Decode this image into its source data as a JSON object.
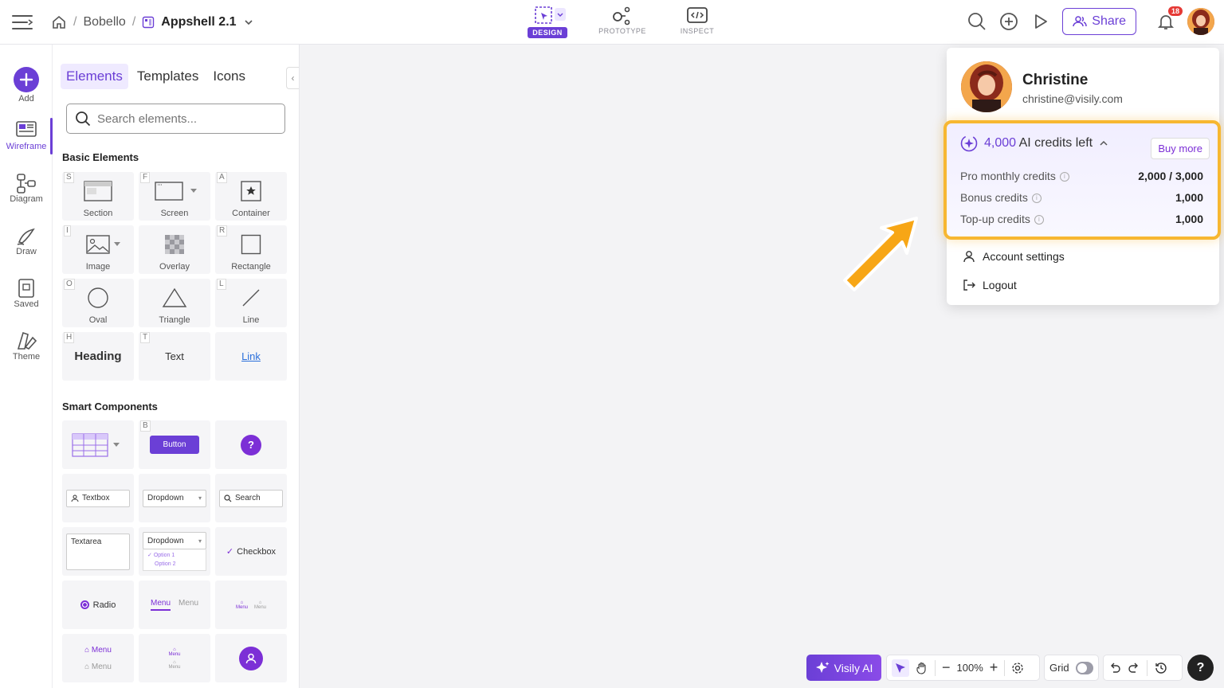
{
  "header": {
    "home_crumb": "Bobello",
    "project_name": "Appshell 2.1",
    "mode_tabs": [
      {
        "label": "DESIGN",
        "icon": "design-icon"
      },
      {
        "label": "PROTOTYPE",
        "icon": "prototype-icon"
      },
      {
        "label": "INSPECT",
        "icon": "inspect-icon"
      }
    ],
    "share_label": "Share",
    "notification_count": "18"
  },
  "rail": {
    "items": [
      {
        "label": "Add"
      },
      {
        "label": "Wireframe"
      },
      {
        "label": "Diagram"
      },
      {
        "label": "Draw"
      },
      {
        "label": "Saved"
      },
      {
        "label": "Theme"
      }
    ]
  },
  "panel": {
    "tabs": [
      "Elements",
      "Templates",
      "Icons"
    ],
    "search_placeholder": "Search elements...",
    "basic_title": "Basic Elements",
    "basic": [
      {
        "key": "S",
        "label": "Section"
      },
      {
        "key": "F",
        "label": "Screen"
      },
      {
        "key": "A",
        "label": "Container"
      },
      {
        "key": "I",
        "label": "Image"
      },
      {
        "key": "",
        "label": "Overlay"
      },
      {
        "key": "R",
        "label": "Rectangle"
      },
      {
        "key": "O",
        "label": "Oval"
      },
      {
        "key": "",
        "label": "Triangle"
      },
      {
        "key": "L",
        "label": "Line"
      },
      {
        "key": "H",
        "label": "Heading"
      },
      {
        "key": "T",
        "label": "Text"
      },
      {
        "key": "",
        "label": "Link"
      }
    ],
    "smart_title": "Smart Components",
    "smart": {
      "button_key": "B",
      "button_label": "Button",
      "help_glyph": "?",
      "textbox": "Textbox",
      "dropdown": "Dropdown",
      "search": "Search",
      "textarea": "Textarea",
      "dropdown2": "Dropdown",
      "option1": "Option 1",
      "option2": "Option 2",
      "checkbox": "Checkbox",
      "radio": "Radio",
      "menu_a": "Menu",
      "menu_b": "Menu"
    }
  },
  "account": {
    "name": "Christine",
    "email": "christine@visily.com",
    "credits_number": "4,000",
    "credits_suffix": "AI credits left",
    "buy_more": "Buy more",
    "rows": [
      {
        "label": "Pro monthly credits",
        "value": "2,000 / 3,000"
      },
      {
        "label": "Bonus credits",
        "value": "1,000"
      },
      {
        "label": "Top-up credits",
        "value": "1,000"
      }
    ],
    "account_settings": "Account settings",
    "logout": "Logout"
  },
  "bottom": {
    "visily_ai": "Visily AI",
    "zoom": "100%",
    "grid_label": "Grid",
    "help_glyph": "?"
  },
  "colors": {
    "accent": "#6b3fd6",
    "highlight": "#f7b731"
  }
}
